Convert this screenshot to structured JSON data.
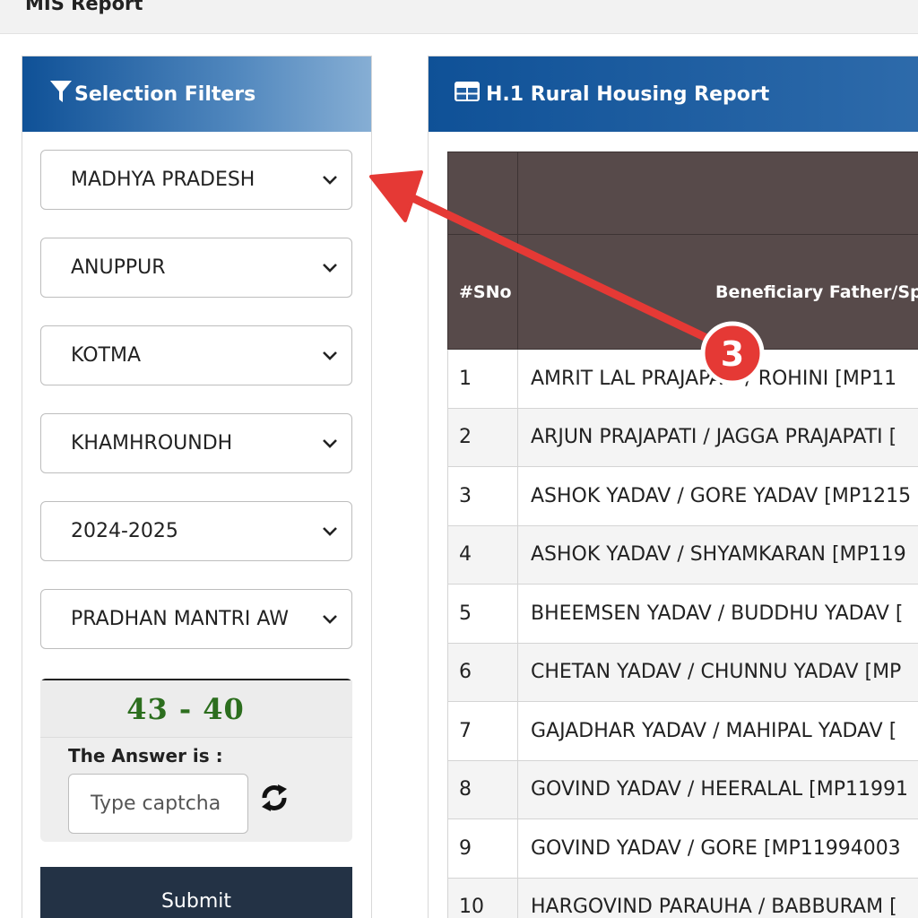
{
  "page": {
    "title": "MIS Report"
  },
  "filters": {
    "header": "Selection Filters",
    "selects": [
      {
        "value": "MADHYA PRADESH"
      },
      {
        "value": "ANUPPUR"
      },
      {
        "value": "KOTMA"
      },
      {
        "value": "KHAMHROUNDH"
      },
      {
        "value": "2024-2025"
      },
      {
        "value": "PRADHAN MANTRI AW"
      }
    ],
    "captcha": {
      "challenge": "43 - 40",
      "answer_label": "The Answer is :",
      "placeholder": "Type captcha"
    },
    "submit_label": "Submit"
  },
  "report": {
    "header": "H.1 Rural Housing Report",
    "columns": {
      "sno": "#SNo",
      "name": "Beneficiary Father/Spo"
    },
    "rows": [
      {
        "sno": "1",
        "name": "AMRIT LAL PRAJAPATI / ROHINI [MP11"
      },
      {
        "sno": "2",
        "name": "ARJUN PRAJAPATI / JAGGA PRAJAPATI ["
      },
      {
        "sno": "3",
        "name": "ASHOK YADAV / GORE YADAV [MP1215"
      },
      {
        "sno": "4",
        "name": "ASHOK YADAV / SHYAMKARAN [MP119"
      },
      {
        "sno": "5",
        "name": "BHEEMSEN YADAV / BUDDHU YADAV ["
      },
      {
        "sno": "6",
        "name": "CHETAN YADAV / CHUNNU YADAV [MP"
      },
      {
        "sno": "7",
        "name": "GAJADHAR YADAV / MAHIPAL YADAV ["
      },
      {
        "sno": "8",
        "name": "GOVIND YADAV / HEERALAL [MP11991"
      },
      {
        "sno": "9",
        "name": "GOVIND YADAV / GORE [MP11994003"
      },
      {
        "sno": "10",
        "name": "HARGOVIND PARAUHA / BABBURAM ["
      }
    ]
  },
  "annotation": {
    "step_number": "3",
    "color": "#e53935"
  }
}
